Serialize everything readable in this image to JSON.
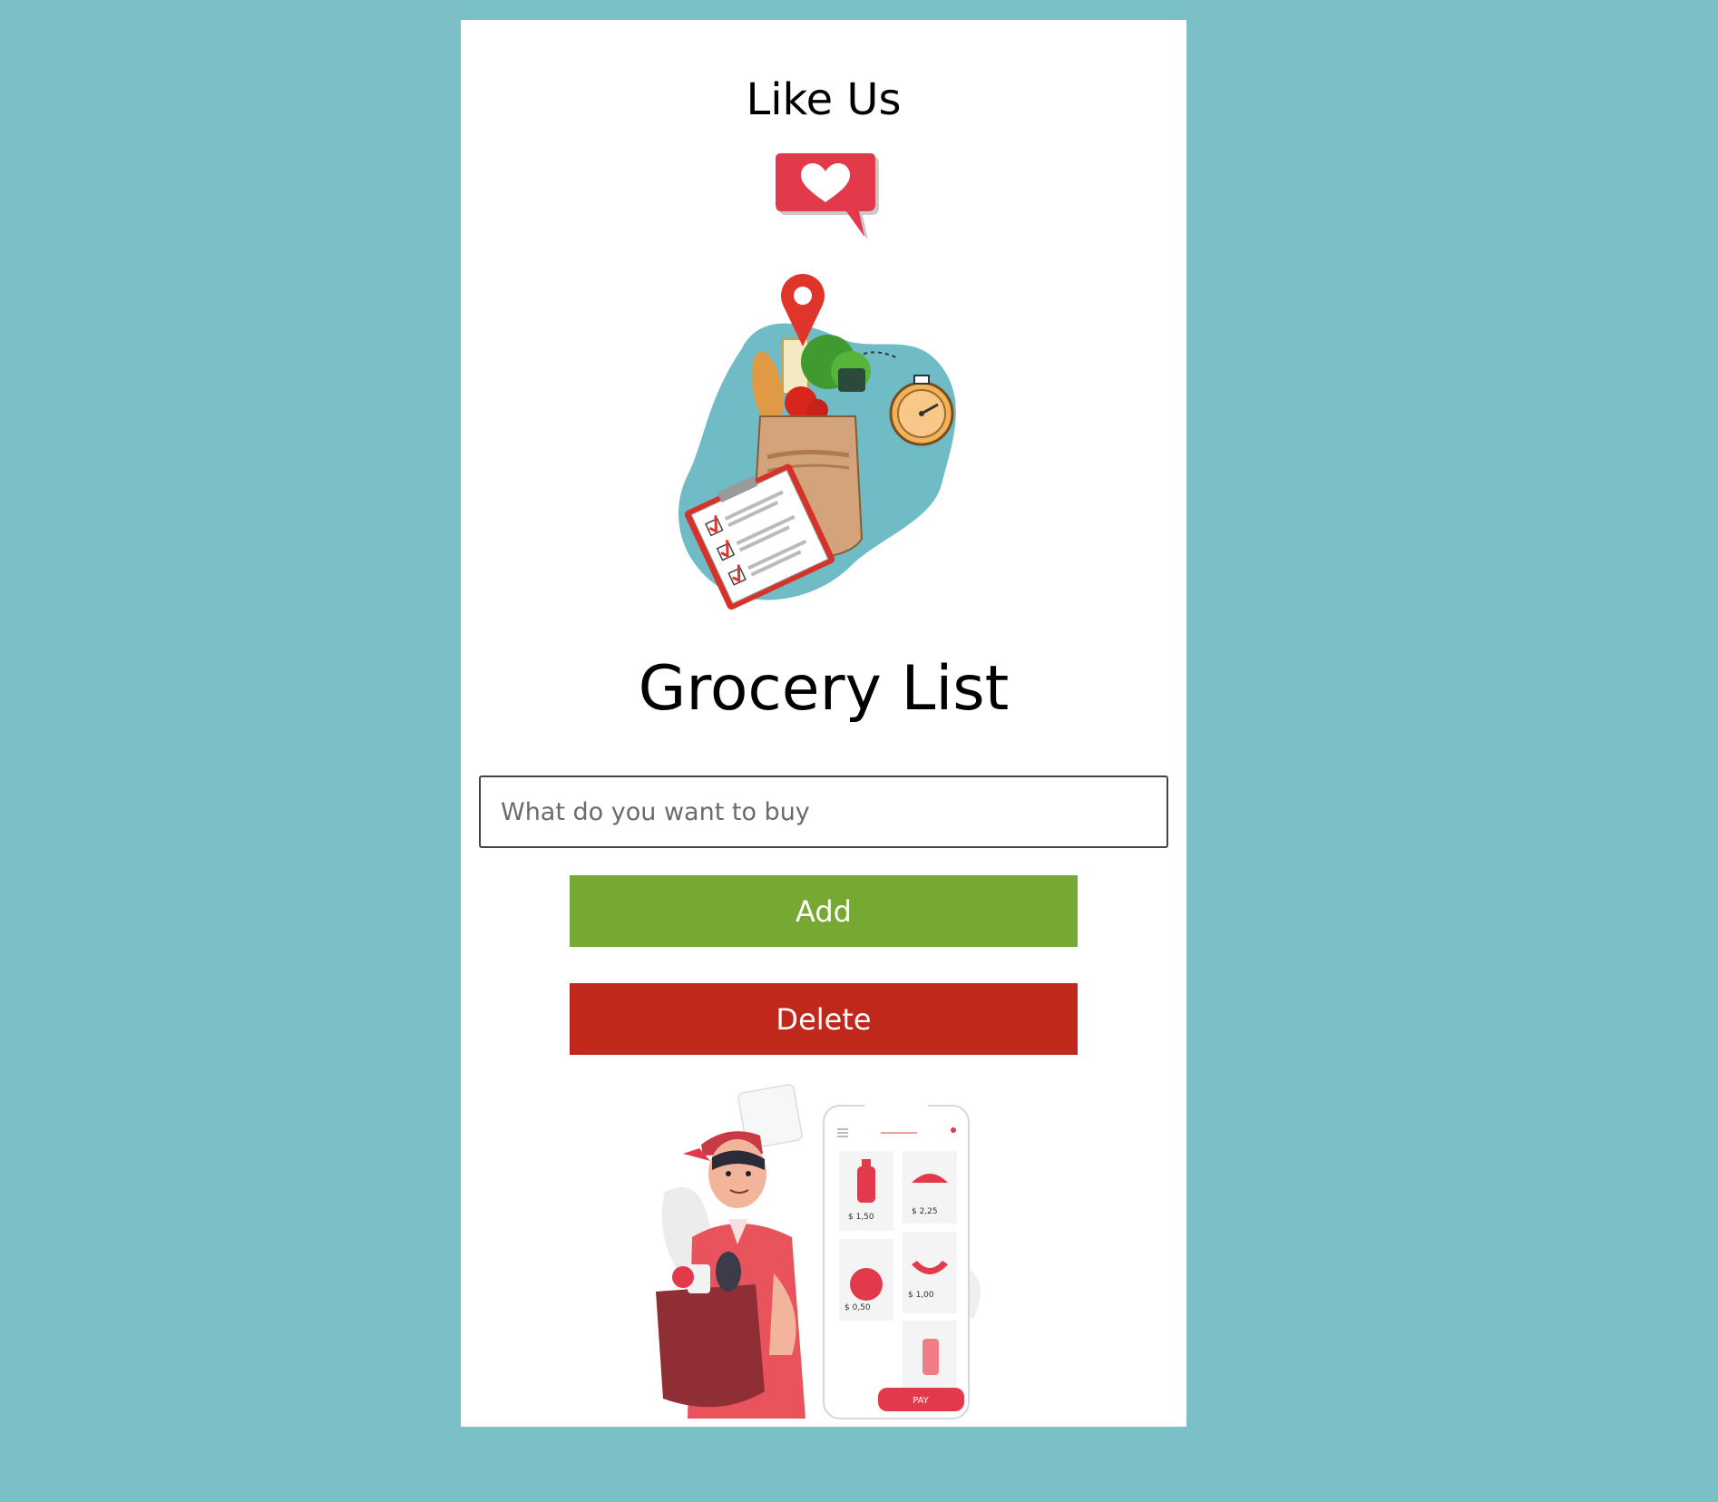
{
  "like": {
    "title": "Like Us"
  },
  "grocery": {
    "title": "Grocery List",
    "input_placeholder": "What do you want to buy",
    "add_label": "Add",
    "delete_label": "Delete"
  },
  "phone_screen": {
    "prices": [
      "$ 1,50",
      "$ 2,25",
      "$ 0,50",
      "$ 1,00"
    ],
    "pay_label": "PAY"
  },
  "colors": {
    "background": "#7cc0c7",
    "add_button": "#78a834",
    "delete_button": "#c0281c",
    "accent_red": "#e2394b"
  },
  "icons": {
    "like": "heart-speech-bubble-icon",
    "hero": "grocery-bag-illustration",
    "footer": "delivery-person-illustration"
  }
}
